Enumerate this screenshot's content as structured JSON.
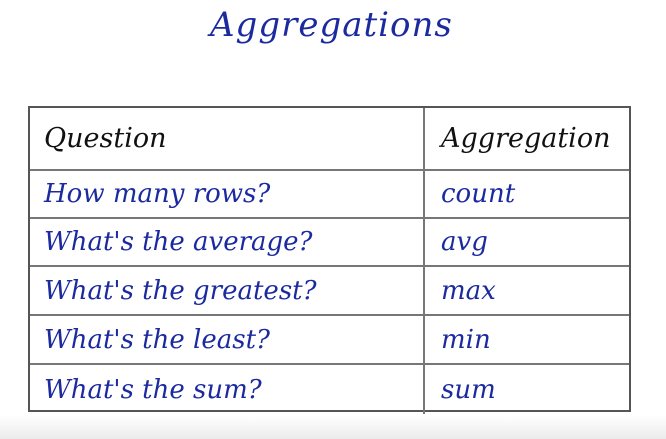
{
  "title": "Aggregations",
  "columns": {
    "question": "Question",
    "aggregation": "Aggregation"
  },
  "rows": [
    {
      "question": "How many rows?",
      "aggregation": "count"
    },
    {
      "question": "What's the average?",
      "aggregation": "avg"
    },
    {
      "question": "What's the greatest?",
      "aggregation": "max"
    },
    {
      "question": "What's the least?",
      "aggregation": "min"
    },
    {
      "question": "What's the sum?",
      "aggregation": "sum"
    }
  ],
  "colors": {
    "ink_blue": "#1b2a9f",
    "ink_black": "#111111",
    "table_lines": "#555555"
  }
}
